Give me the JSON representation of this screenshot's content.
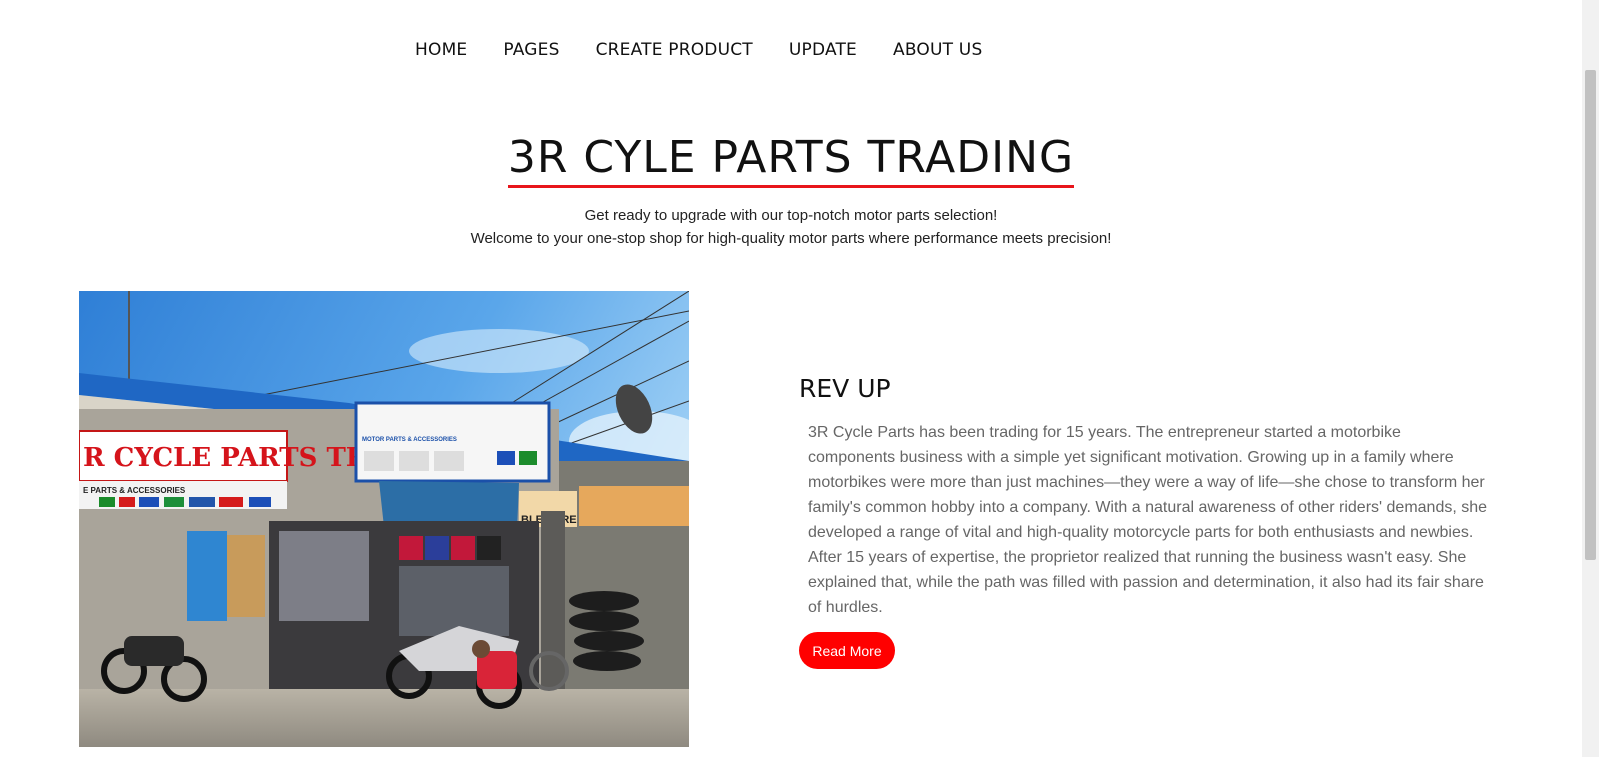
{
  "nav": {
    "items": [
      "HOME",
      "PAGES",
      "CREATE PRODUCT",
      "UPDATE",
      "ABOUT US"
    ]
  },
  "hero": {
    "title": "3R CYLE PARTS TRADING",
    "line1": "Get ready to upgrade with our top-notch motor parts selection!",
    "line2": "Welcome to your one-stop shop for high-quality motor parts where performance meets precision!"
  },
  "photo": {
    "sign_main": "R CYCLE PARTS TRADING",
    "sign_sub": "E PARTS & ACCESSORIES",
    "sign_upper": "MOTOR PARTS & ACCESSORIES",
    "sign_right": "BLE HERE"
  },
  "section": {
    "heading": "REV UP",
    "body": "3R Cycle Parts has been trading for 15 years. The entrepreneur started a motorbike components business with a simple yet significant motivation. Growing up in a family where motorbikes were more than just machines—they were a way of life—she chose to transform her family's common hobby into a company. With a natural awareness of other riders' demands, she developed a range of vital and high-quality motorcycle parts for both enthusiasts and newbies. After 15 years of expertise, the proprietor realized that running the business wasn't easy. She explained that, while the path was filled with passion and determination, it also had its fair share of hurdles.",
    "button_label": "Read More"
  },
  "colors": {
    "accent": "#ff0000",
    "underline": "#e8151b",
    "body_text": "#666666"
  }
}
